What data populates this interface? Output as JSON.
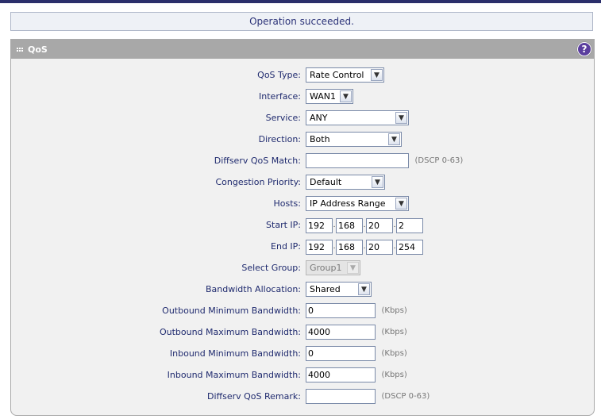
{
  "status": {
    "message": "Operation succeeded."
  },
  "panel": {
    "title": "QoS",
    "help_icon": "?"
  },
  "form": {
    "qos_type": {
      "label": "QoS Type:",
      "value": "Rate Control"
    },
    "interface": {
      "label": "Interface:",
      "value": "WAN1"
    },
    "service": {
      "label": "Service:",
      "value": "ANY"
    },
    "direction": {
      "label": "Direction:",
      "value": "Both"
    },
    "diffserv_match": {
      "label": "Diffserv QoS Match:",
      "value": "",
      "hint": "(DSCP 0-63)"
    },
    "congestion_priority": {
      "label": "Congestion Priority:",
      "value": "Default"
    },
    "hosts": {
      "label": "Hosts:",
      "value": "IP Address Range"
    },
    "start_ip": {
      "label": "Start IP:",
      "octets": [
        "192",
        "168",
        "20",
        "2"
      ]
    },
    "end_ip": {
      "label": "End IP:",
      "octets": [
        "192",
        "168",
        "20",
        "254"
      ]
    },
    "select_group": {
      "label": "Select Group:",
      "value": "Group1"
    },
    "bandwidth_allocation": {
      "label": "Bandwidth Allocation:",
      "value": "Shared"
    },
    "outbound_min": {
      "label": "Outbound Minimum Bandwidth:",
      "value": "0",
      "hint": "(Kbps)"
    },
    "outbound_max": {
      "label": "Outbound Maximum Bandwidth:",
      "value": "4000",
      "hint": "(Kbps)"
    },
    "inbound_min": {
      "label": "Inbound Minimum Bandwidth:",
      "value": "0",
      "hint": "(Kbps)"
    },
    "inbound_max": {
      "label": "Inbound Maximum Bandwidth:",
      "value": "4000",
      "hint": "(Kbps)"
    },
    "diffserv_remark": {
      "label": "Diffserv QoS Remark:",
      "value": "",
      "hint": "(DSCP 0-63)"
    }
  },
  "colors": {
    "header_bg": "#a8a8a8",
    "panel_bg": "#f1f1f1",
    "label_text": "#1f2a6e",
    "help_icon": "#5b3f9e",
    "top_bar": "#2b2f6b"
  }
}
